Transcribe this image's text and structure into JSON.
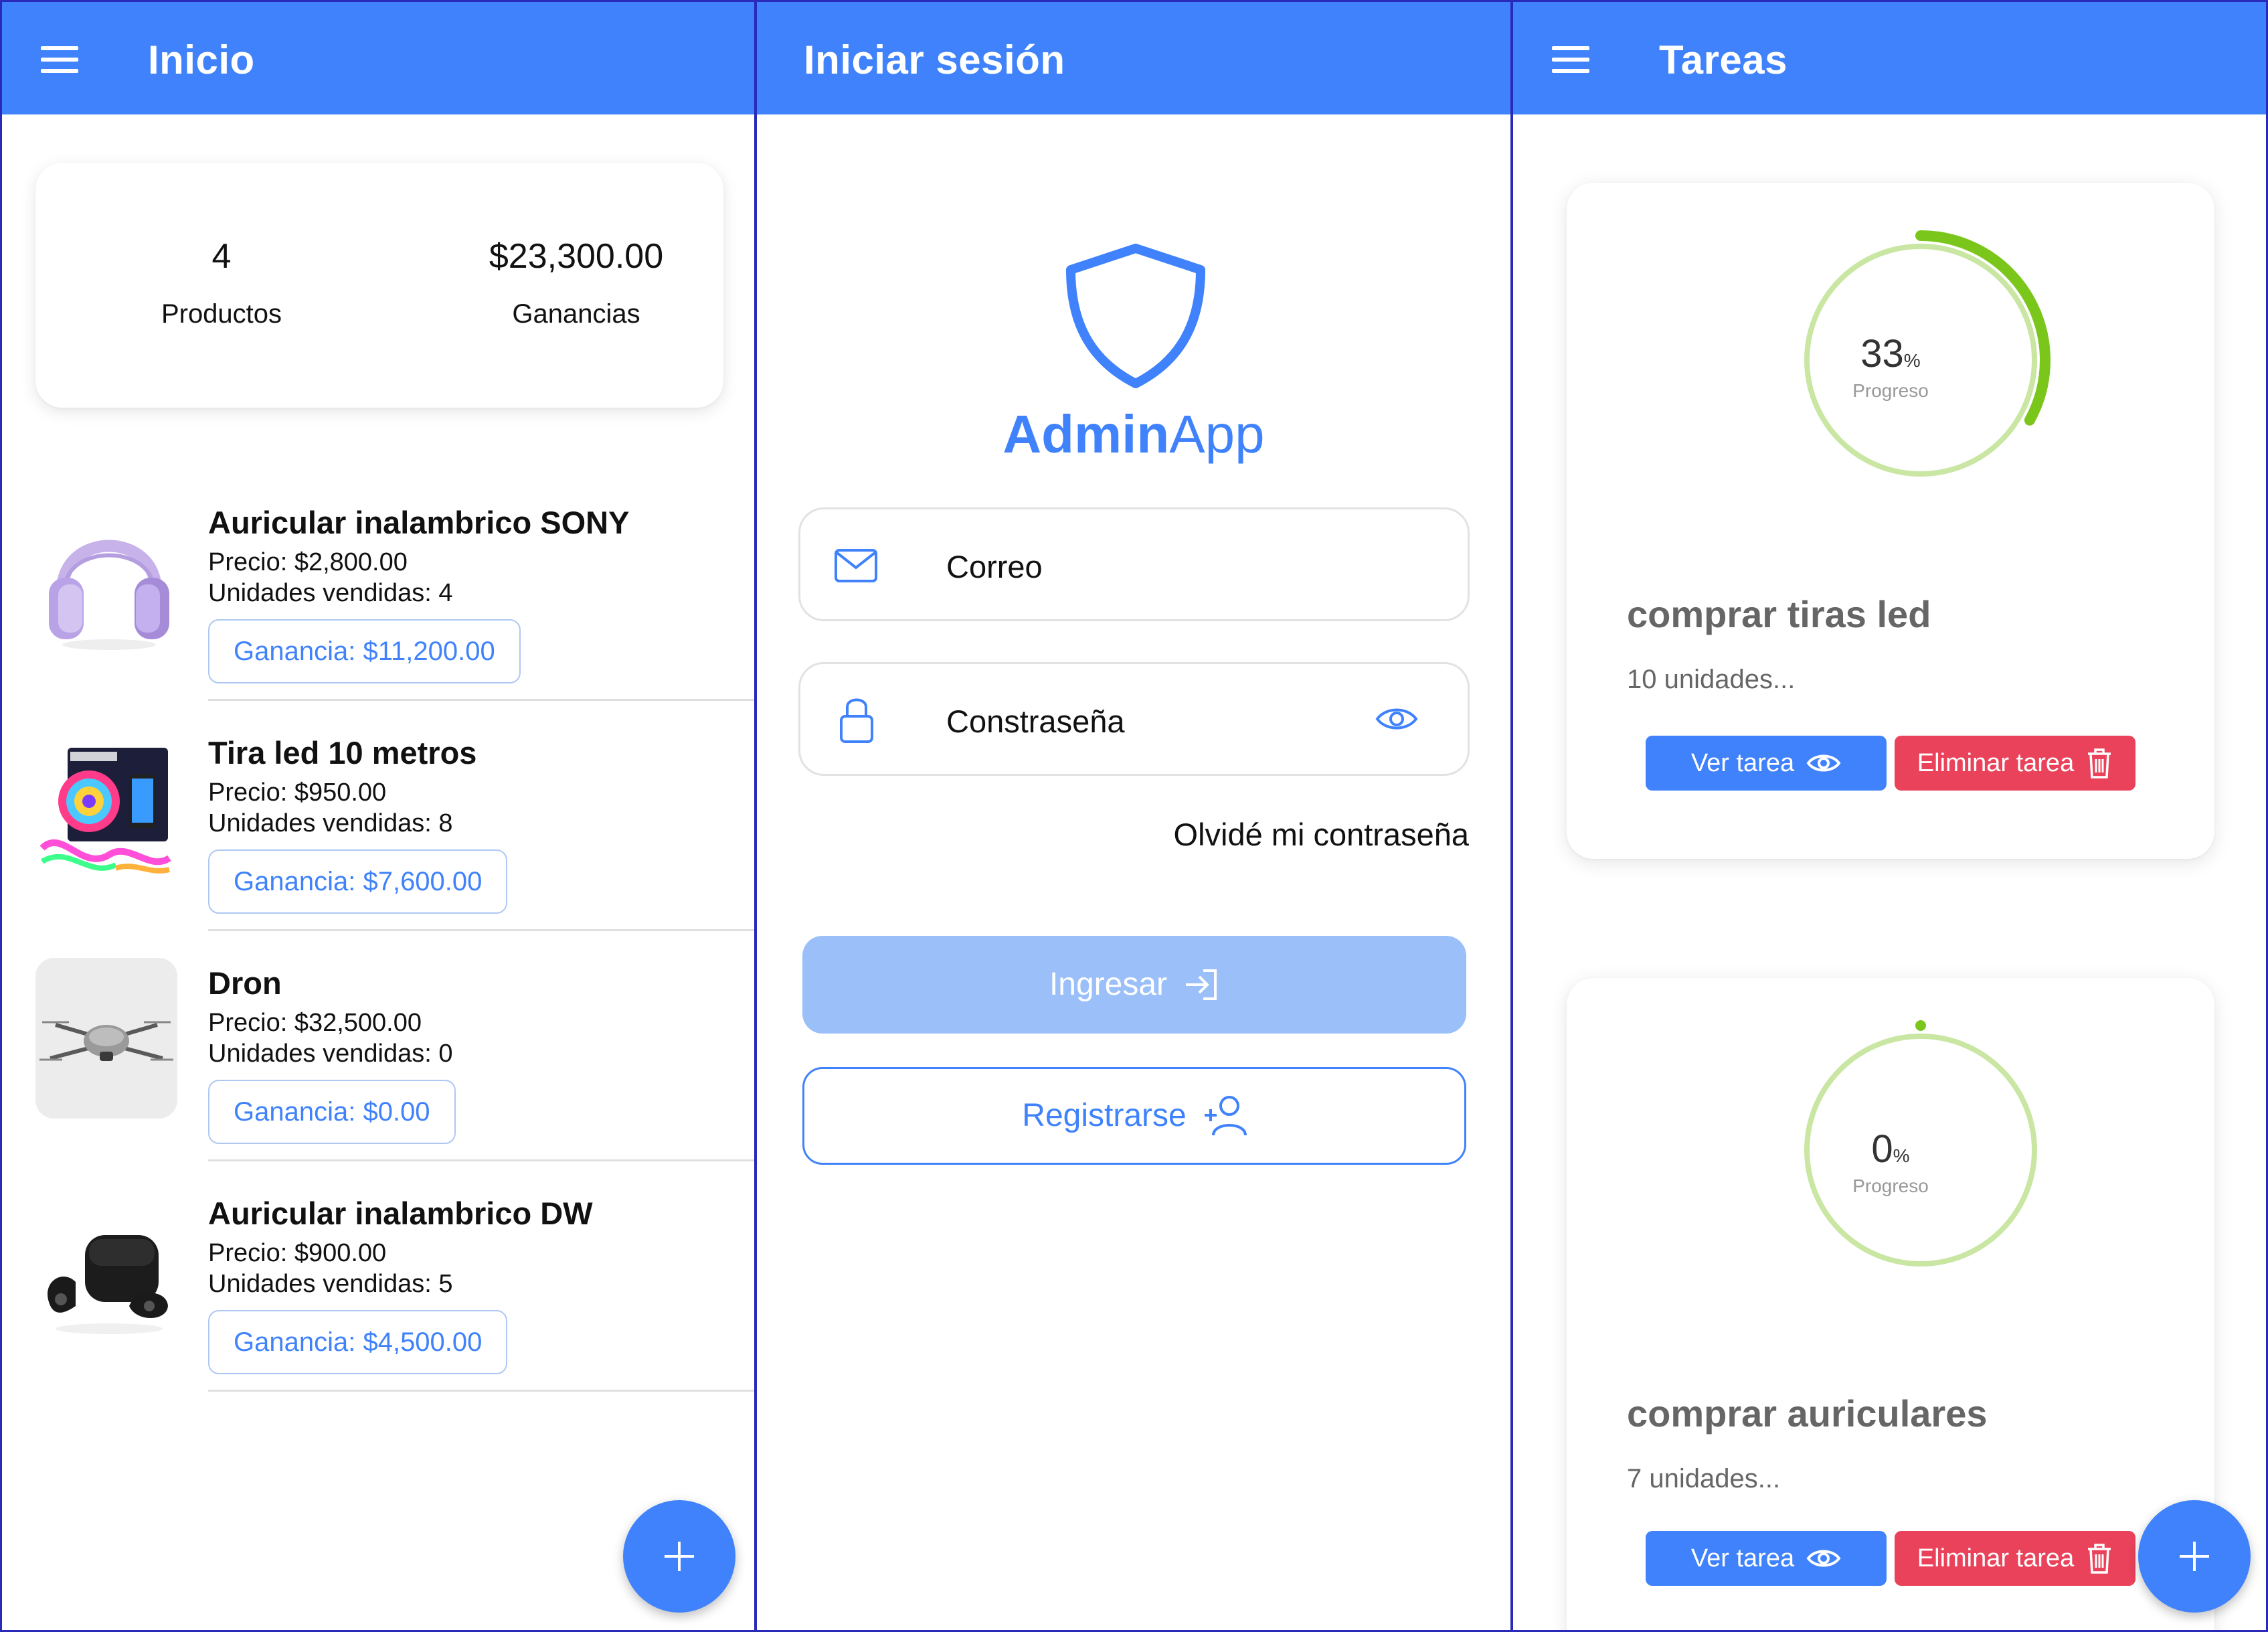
{
  "colors": {
    "primary": "#3f82fb",
    "danger": "#e9425a",
    "progress": "#7ac61a",
    "progress_track": "#c9e6a3"
  },
  "home": {
    "title": "Inicio",
    "stats": {
      "products_count": "4",
      "products_label": "Productos",
      "earnings_value": "$23,300.00",
      "earnings_label": "Ganancias"
    },
    "products": [
      {
        "name": "Auricular inalambrico SONY",
        "price": "Precio: $2,800.00",
        "units": "Unidades vendidas: 4",
        "gain": "Ganancia: $11,200.00",
        "image": "purple-headphones"
      },
      {
        "name": "Tira led 10 metros",
        "price": "Precio: $950.00",
        "units": "Unidades vendidas: 8",
        "gain": "Ganancia: $7,600.00",
        "image": "led-strip-box"
      },
      {
        "name": "Dron",
        "price": "Precio: $32,500.00",
        "units": "Unidades vendidas: 0",
        "gain": "Ganancia: $0.00",
        "image": "drone"
      },
      {
        "name": "Auricular inalambrico DW",
        "price": "Precio: $900.00",
        "units": "Unidades vendidas: 5",
        "gain": "Ganancia: $4,500.00",
        "image": "black-earbuds"
      }
    ],
    "fab_icon": "plus-icon"
  },
  "login": {
    "title": "Iniciar sesión",
    "brand_bold": "Admin",
    "brand_light": "App",
    "email_label": "Correo",
    "password_label": "Constraseña",
    "forgot": "Olvidé mi contraseña",
    "login_button": "Ingresar",
    "register_button": "Registrarse"
  },
  "tasks": {
    "title": "Tareas",
    "items": [
      {
        "progress": 33,
        "pct_value": "33",
        "pct_symbol": "%",
        "progress_label": "Progreso",
        "title": "comprar tiras led",
        "subtitle": "10 unidades...",
        "view_label": "Ver tarea",
        "delete_label": "Eliminar tarea"
      },
      {
        "progress": 0,
        "pct_value": "0",
        "pct_symbol": "%",
        "progress_label": "Progreso",
        "title": "comprar auriculares",
        "subtitle": "7 unidades...",
        "view_label": "Ver tarea",
        "delete_label": "Eliminar tarea"
      }
    ]
  }
}
